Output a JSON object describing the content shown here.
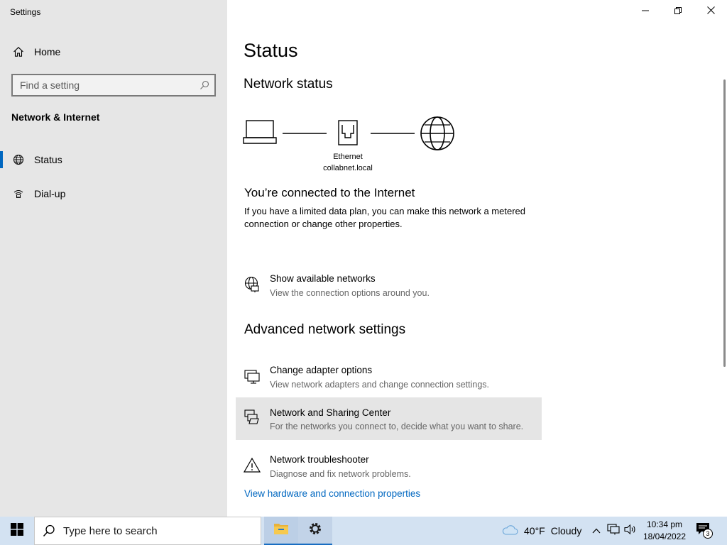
{
  "window": {
    "title": "Settings",
    "controls": {
      "minimize": "minimize-icon",
      "maximize": "restore-icon",
      "close": "close-icon"
    }
  },
  "sidebar": {
    "home_label": "Home",
    "search_placeholder": "Find a setting",
    "section_title": "Network & Internet",
    "items": [
      {
        "label": "Status",
        "icon": "status-icon",
        "selected": true
      },
      {
        "label": "Dial-up",
        "icon": "dial-up-icon",
        "selected": false
      }
    ]
  },
  "main": {
    "title": "Status",
    "network_status_heading": "Network status",
    "diagram": {
      "adapter_name": "Ethernet",
      "domain": "collabnet.local"
    },
    "connected_heading": "You’re connected to the Internet",
    "connected_desc": "If you have a limited data plan, you can make this network a metered connection or change other properties.",
    "show_networks": {
      "title": "Show available networks",
      "desc": "View the connection options around you."
    },
    "advanced_heading": "Advanced network settings",
    "options": [
      {
        "title": "Change adapter options",
        "desc": "View network adapters and change connection settings."
      },
      {
        "title": "Network and Sharing Center",
        "desc": "For the networks you connect to, decide what you want to share."
      },
      {
        "title": "Network troubleshooter",
        "desc": "Diagnose and fix network problems."
      }
    ],
    "hardware_link": "View hardware and connection properties"
  },
  "taskbar": {
    "search_placeholder": "Type here to search",
    "weather_temp": "40°F",
    "weather_cond": "Cloudy",
    "time": "10:34 pm",
    "date": "18/04/2022",
    "notification_count": "3",
    "accent": "#0067c0"
  }
}
